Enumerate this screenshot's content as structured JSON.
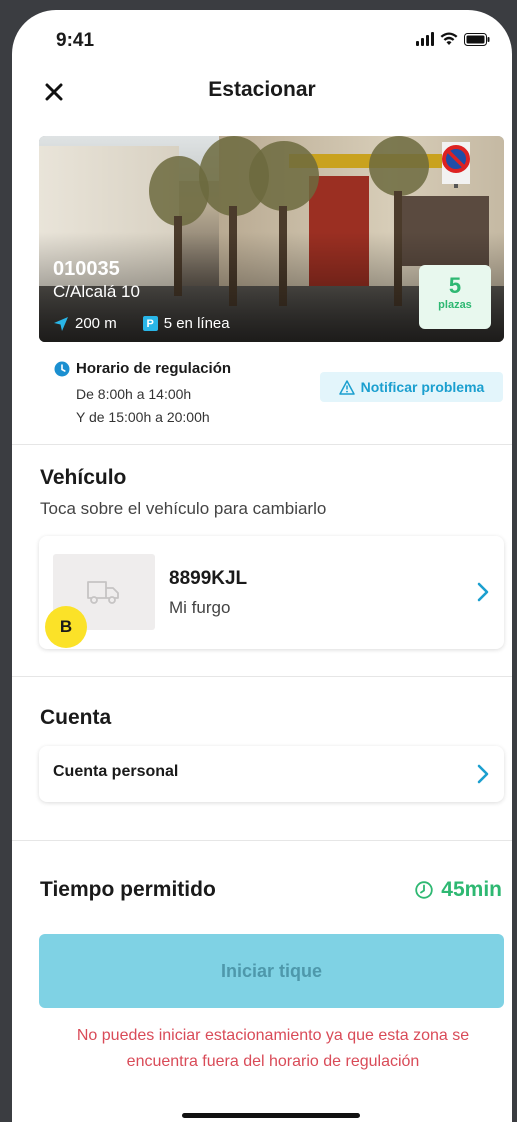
{
  "status_bar": {
    "time": "9:41"
  },
  "header": {
    "title": "Estacionar"
  },
  "zone": {
    "code": "010035",
    "street": "C/Alcalá 10",
    "distance": "200 m",
    "parking_badge": "P",
    "online_count": "5 en línea",
    "spots_count": "5",
    "spots_label": "plazas"
  },
  "schedule": {
    "title": "Horario de regulación",
    "line1": "De 8:00h a 14:00h",
    "line2": "Y de 15:00h a 20:00h",
    "notify_label": "Notificar problema"
  },
  "vehicle": {
    "section_title": "Vehículo",
    "subtitle": "Toca sobre el vehículo para cambiarlo",
    "plate": "8899KJL",
    "name": "Mi furgo",
    "badge": "B"
  },
  "account": {
    "section_title": "Cuenta",
    "value": "Cuenta personal"
  },
  "time": {
    "title": "Tiempo permitido",
    "value": "45min"
  },
  "action": {
    "start_label": "Iniciar tique",
    "error": "No puedes iniciar estacionamiento ya que esta zona se encuentra fuera del horario de regulación"
  },
  "colors": {
    "accent": "#29b6e8",
    "success": "#2eb872",
    "error": "#d94b58",
    "button_disabled": "#7fd2e4",
    "badge_yellow": "#fbe228"
  },
  "icons": [
    "close-icon",
    "location-arrow-icon",
    "parking-icon",
    "clock-icon",
    "warning-icon",
    "truck-icon",
    "chevron-right-icon",
    "signal-icon",
    "wifi-icon",
    "battery-icon"
  ]
}
